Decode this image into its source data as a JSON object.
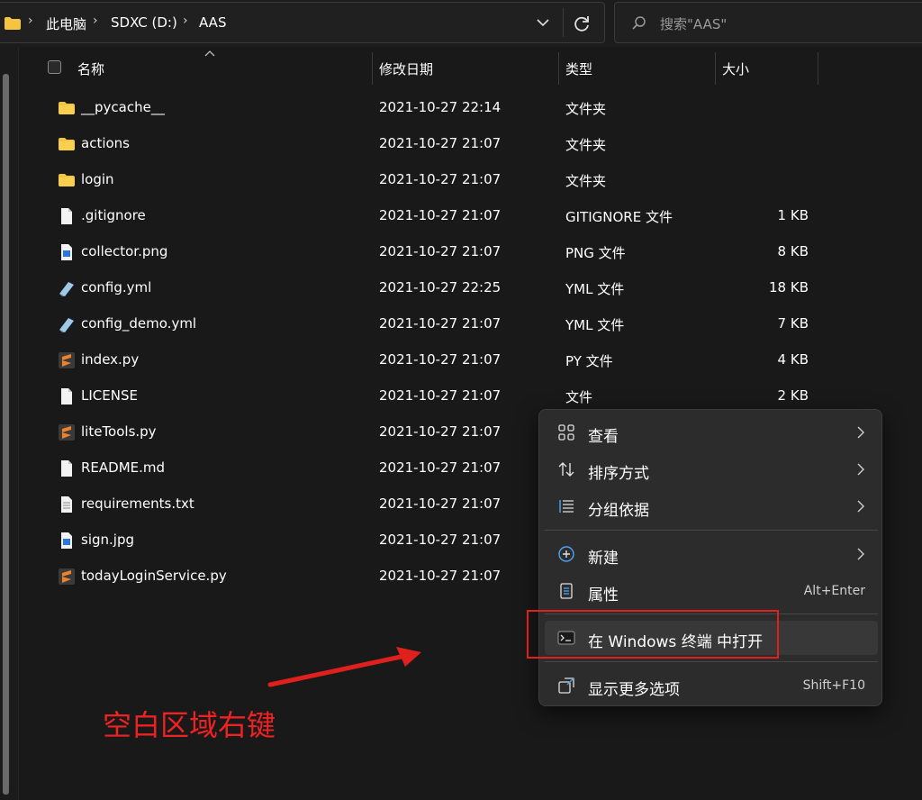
{
  "addressbar": {
    "crumbs": [
      "此电脑",
      "SDXC (D:)",
      "AAS"
    ],
    "separator": "›",
    "search_placeholder": "搜索\"AAS\""
  },
  "columns": {
    "name": "名称",
    "modified": "修改日期",
    "type": "类型",
    "size": "大小"
  },
  "files": [
    {
      "name": "__pycache__",
      "modified": "2021-10-27 22:14",
      "type": "文件夹",
      "size": "",
      "icon": "folder-icon"
    },
    {
      "name": "actions",
      "modified": "2021-10-27 21:07",
      "type": "文件夹",
      "size": "",
      "icon": "folder-icon"
    },
    {
      "name": "login",
      "modified": "2021-10-27 21:07",
      "type": "文件夹",
      "size": "",
      "icon": "folder-icon"
    },
    {
      "name": ".gitignore",
      "modified": "2021-10-27 21:07",
      "type": "GITIGNORE 文件",
      "size": "1 KB",
      "icon": "file-icon"
    },
    {
      "name": "collector.png",
      "modified": "2021-10-27 21:07",
      "type": "PNG 文件",
      "size": "8 KB",
      "icon": "image-file-icon"
    },
    {
      "name": "config.yml",
      "modified": "2021-10-27 22:25",
      "type": "YML 文件",
      "size": "18 KB",
      "icon": "yml-file-icon"
    },
    {
      "name": "config_demo.yml",
      "modified": "2021-10-27 21:07",
      "type": "YML 文件",
      "size": "7 KB",
      "icon": "yml-file-icon"
    },
    {
      "name": "index.py",
      "modified": "2021-10-27 21:07",
      "type": "PY 文件",
      "size": "4 KB",
      "icon": "sublime-file-icon"
    },
    {
      "name": "LICENSE",
      "modified": "2021-10-27 21:07",
      "type": "文件",
      "size": "2 KB",
      "icon": "file-icon"
    },
    {
      "name": "liteTools.py",
      "modified": "2021-10-27 21:07",
      "type": "",
      "size": "",
      "icon": "sublime-file-icon"
    },
    {
      "name": "README.md",
      "modified": "2021-10-27 21:07",
      "type": "",
      "size": "",
      "icon": "file-icon"
    },
    {
      "name": "requirements.txt",
      "modified": "2021-10-27 21:07",
      "type": "",
      "size": "",
      "icon": "text-file-icon"
    },
    {
      "name": "sign.jpg",
      "modified": "2021-10-27 21:07",
      "type": "",
      "size": "",
      "icon": "image-file-icon"
    },
    {
      "name": "todayLoginService.py",
      "modified": "2021-10-27 21:07",
      "type": "",
      "size": "",
      "icon": "sublime-file-icon"
    }
  ],
  "context_menu": {
    "view": "查看",
    "sort_by": "排序方式",
    "group_by": "分组依据",
    "new": "新建",
    "properties": "属性",
    "properties_shortcut": "Alt+Enter",
    "open_in_terminal": "在 Windows 终端 中打开",
    "show_more": "显示更多选项",
    "show_more_shortcut": "Shift+F10"
  },
  "annotation": {
    "text": "空白区域右键",
    "color": "#ee2222"
  },
  "colors": {
    "background": "#191919",
    "menu": "#2c2c2c",
    "folder": "#f5c542",
    "sublime": "#f0822c",
    "accent_red": "#e0201c"
  }
}
